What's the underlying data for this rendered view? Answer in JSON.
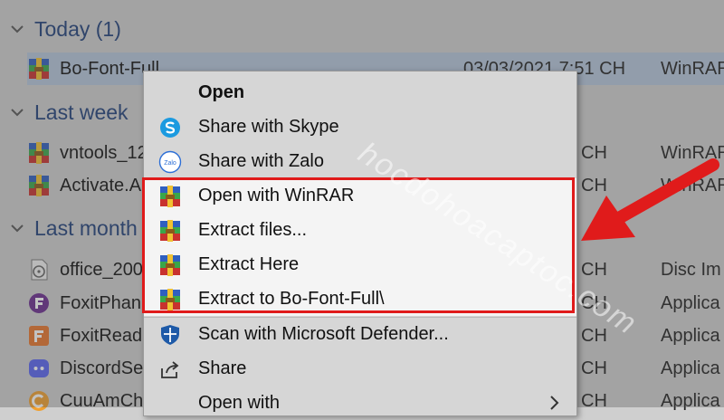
{
  "explorer": {
    "groups": {
      "today": "Today (1)",
      "last_week": "Last week",
      "last_month": "Last month"
    },
    "files": [
      {
        "name": "Bo-Font-Full",
        "date": "03/03/2021 7:51 CH",
        "type": "WinRAR",
        "icon": "winrar-icon",
        "selected": true
      },
      {
        "name": "vntools_12",
        "date": "CH",
        "type": "WinRAR",
        "icon": "winrar-icon"
      },
      {
        "name": "Activate.A",
        "date": "CH",
        "type": "WinRAR",
        "icon": "winrar-icon"
      },
      {
        "name": "office_200",
        "date": "CH",
        "type": "Disc Im",
        "icon": "disc-image-icon"
      },
      {
        "name": "FoxitPhan",
        "date": "CH",
        "type": "Applica",
        "icon": "foxit-phantom-icon"
      },
      {
        "name": "FoxitRead",
        "date": "CH",
        "type": "Applica",
        "icon": "foxit-reader-icon"
      },
      {
        "name": "DiscordSe",
        "date": "CH",
        "type": "Applica",
        "icon": "discord-icon"
      },
      {
        "name": "CuuAmCh",
        "date": "CH",
        "type": "Applica",
        "icon": "cuuam-icon"
      }
    ]
  },
  "context_menu": {
    "items": [
      {
        "label": "Open",
        "icon": ""
      },
      {
        "label": "Share with Skype",
        "icon": "skype-icon"
      },
      {
        "label": "Share with Zalo",
        "icon": "zalo-icon"
      },
      {
        "label": "Open with WinRAR",
        "icon": "winrar-icon"
      },
      {
        "label": "Extract files...",
        "icon": "winrar-icon"
      },
      {
        "label": "Extract Here",
        "icon": "winrar-icon"
      },
      {
        "label": "Extract to Bo-Font-Full\\",
        "icon": "winrar-icon"
      },
      {
        "label": "Scan with Microsoft Defender...",
        "icon": "defender-shield-icon"
      },
      {
        "label": "Share",
        "icon": "share-icon"
      },
      {
        "label": "Open with",
        "icon": ""
      }
    ],
    "zalo_icon_text": "Zalo"
  },
  "watermark": "hocdohoacaptoc.com",
  "colors": {
    "highlight_border": "#e01b1b",
    "arrow": "#e01b1b",
    "group_header": "#1f3f7a",
    "selected_row": "#b6c7dc"
  }
}
